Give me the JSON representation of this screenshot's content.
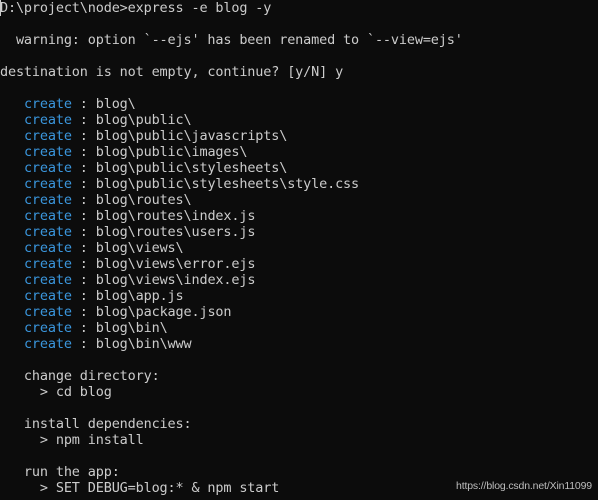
{
  "terminal": {
    "colors": {
      "background": "#0c0c0c",
      "foreground": "#cccccc",
      "create_keyword": "#3a96dd"
    },
    "prompt_line": "D:\\project\\node>express -e blog -y",
    "warning_line": "  warning: option `--ejs' has been renamed to `--view=ejs'",
    "confirm_line": "destination is not empty, continue? [y/N] y",
    "create_keyword": "create",
    "create_separator": " : ",
    "created_paths": [
      "blog\\",
      "blog\\public\\",
      "blog\\public\\javascripts\\",
      "blog\\public\\images\\",
      "blog\\public\\stylesheets\\",
      "blog\\public\\stylesheets\\style.css",
      "blog\\routes\\",
      "blog\\routes\\index.js",
      "blog\\routes\\users.js",
      "blog\\views\\",
      "blog\\views\\error.ejs",
      "blog\\views\\index.ejs",
      "blog\\app.js",
      "blog\\package.json",
      "blog\\bin\\",
      "blog\\bin\\www"
    ],
    "steps": [
      {
        "heading": "change directory:",
        "command": "> cd blog"
      },
      {
        "heading": "install dependencies:",
        "command": "> npm install"
      },
      {
        "heading": "run the app:",
        "command": "> SET DEBUG=blog:* & npm start"
      }
    ]
  },
  "watermark": "https://blog.csdn.net/Xin11099"
}
